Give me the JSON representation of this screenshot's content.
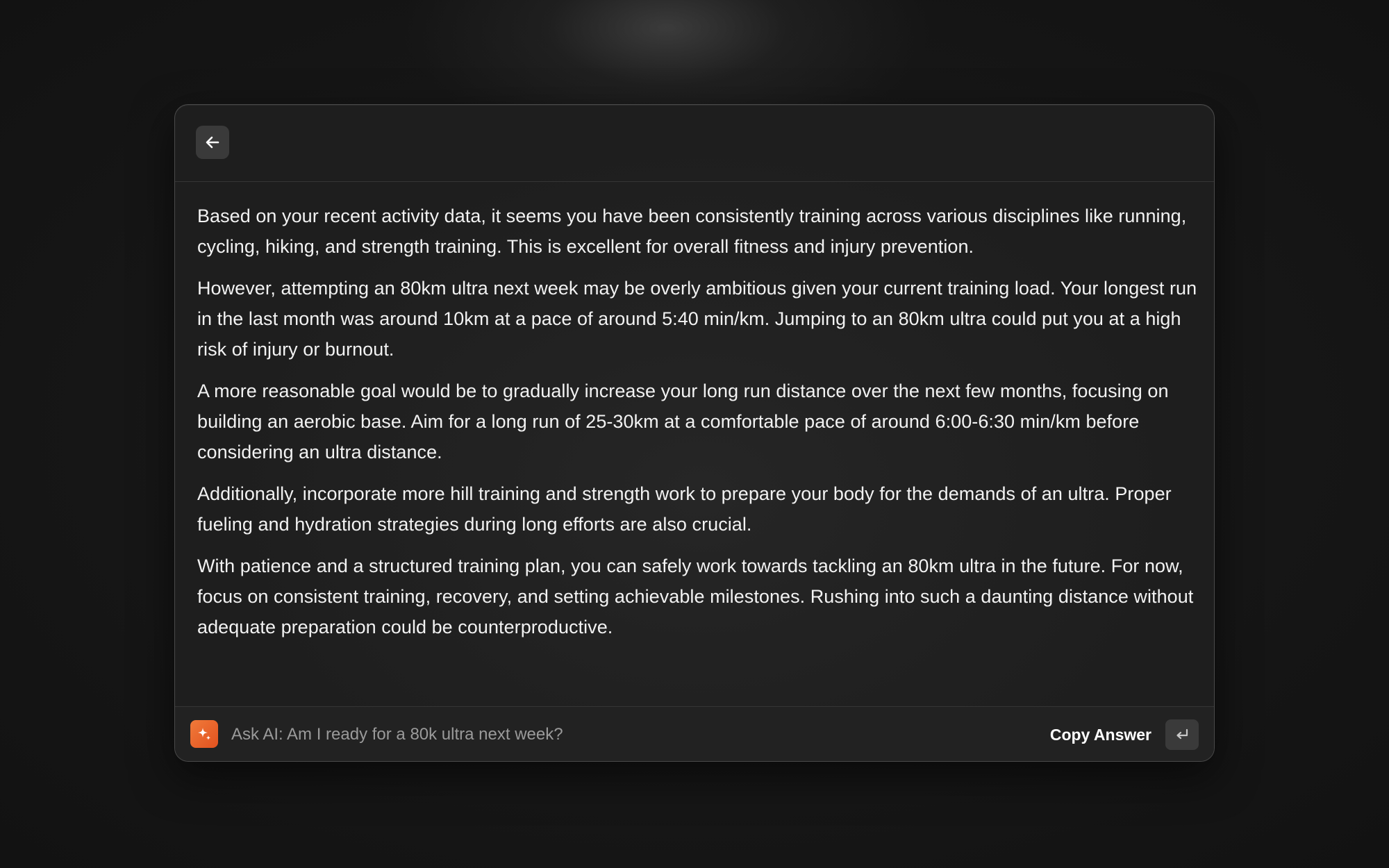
{
  "header": {
    "back_icon": "arrow-left-icon"
  },
  "answer": {
    "paragraphs": [
      "Based on your recent activity data, it seems you have been consistently training across various disciplines like running, cycling, hiking, and strength training. This is excellent for overall fitness and injury prevention.",
      "However, attempting an 80km ultra next week may be overly ambitious given your current training load. Your longest run in the last month was around 10km at a pace of around 5:40 min/km. Jumping to an 80km ultra could put you at a high risk of injury or burnout.",
      "A more reasonable goal would be to gradually increase your long run distance over the next few months, focusing on building an aerobic base. Aim for a long run of 25-30km at a comfortable pace of around 6:00-6:30 min/km before considering an ultra distance.",
      "Additionally, incorporate more hill training and strength work to prepare your body for the demands of an ultra. Proper fueling and hydration strategies during long efforts are also crucial.",
      "With patience and a structured training plan, you can safely work towards tackling an 80km ultra in the future. For now, focus on consistent training, recovery, and setting achievable milestones. Rushing into such a daunting distance without adequate preparation could be counterproductive."
    ]
  },
  "footer": {
    "ai_icon": "sparkle-icon",
    "ai_badge_color": "#e9652c",
    "ask_value": "Ask AI: Am I ready for a 80k ultra next week?",
    "copy_label": "Copy Answer",
    "enter_icon": "return-key-icon"
  }
}
